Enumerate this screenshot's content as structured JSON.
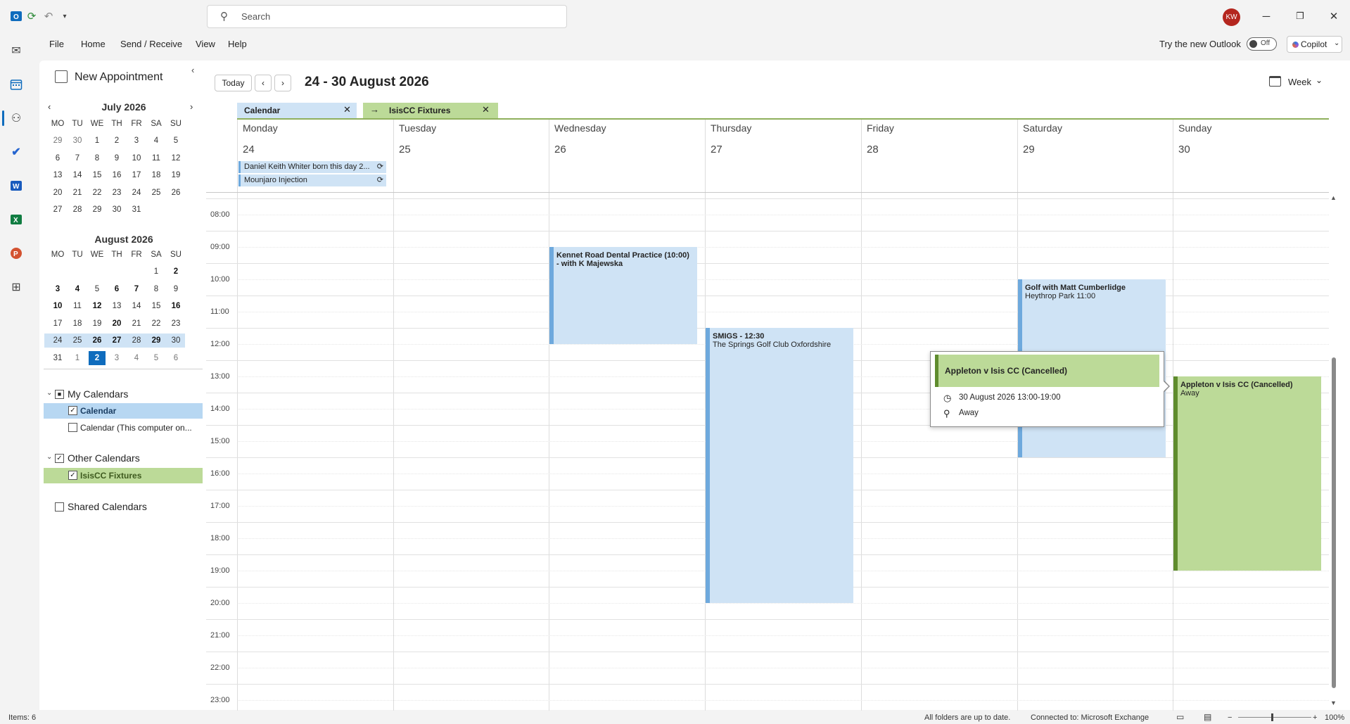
{
  "app": {
    "search_placeholder": "Search",
    "avatar_initials": "KW",
    "brand_color": "#0f6cbd"
  },
  "menu": [
    "File",
    "Home",
    "Send / Receive",
    "View",
    "Help"
  ],
  "try_new": {
    "label": "Try the new Outlook",
    "toggle": "Off"
  },
  "copilot_label": "Copilot",
  "folder": {
    "new_appointment": "New Appointment",
    "july": {
      "title": "July 2026",
      "dow": [
        "MO",
        "TU",
        "WE",
        "TH",
        "FR",
        "SA",
        "SU"
      ],
      "weeks": [
        [
          "29",
          "30",
          "1",
          "2",
          "3",
          "4",
          "5"
        ],
        [
          "6",
          "7",
          "8",
          "9",
          "10",
          "11",
          "12"
        ],
        [
          "13",
          "14",
          "15",
          "16",
          "17",
          "18",
          "19"
        ],
        [
          "20",
          "21",
          "22",
          "23",
          "24",
          "25",
          "26"
        ],
        [
          "27",
          "28",
          "29",
          "30",
          "31",
          "",
          ""
        ]
      ]
    },
    "august": {
      "title": "August 2026",
      "dow": [
        "MO",
        "TU",
        "WE",
        "TH",
        "FR",
        "SA",
        "SU"
      ],
      "weeks": [
        [
          "",
          "",
          "",
          "",
          "",
          "1",
          "2"
        ],
        [
          "3",
          "4",
          "5",
          "6",
          "7",
          "8",
          "9"
        ],
        [
          "10",
          "11",
          "12",
          "13",
          "14",
          "15",
          "16"
        ],
        [
          "17",
          "18",
          "19",
          "20",
          "21",
          "22",
          "23"
        ],
        [
          "24",
          "25",
          "26",
          "27",
          "28",
          "29",
          "30"
        ],
        [
          "31",
          "1",
          "2",
          "3",
          "4",
          "5",
          "6"
        ]
      ],
      "bold_days": [
        "2",
        "3",
        "4",
        "6",
        "7",
        "10",
        "12",
        "16",
        "20",
        "26",
        "27",
        "29"
      ],
      "selected_week_index": 4,
      "today": "2"
    },
    "my_calendars": "My Calendars",
    "calendar_item": "Calendar",
    "calendar_local": "Calendar (This computer on...",
    "other_calendars": "Other Calendars",
    "isiscc_item": "IsisCC Fixtures",
    "shared_calendars": "Shared Calendars"
  },
  "toolbar": {
    "today": "Today",
    "date_range": "24 - 30 August 2026",
    "view": "Week"
  },
  "tabs": {
    "calendar": "Calendar",
    "isiscc": "IsisCC Fixtures"
  },
  "days": [
    {
      "name": "Monday",
      "num": "24"
    },
    {
      "name": "Tuesday",
      "num": "25"
    },
    {
      "name": "Wednesday",
      "num": "26"
    },
    {
      "name": "Thursday",
      "num": "27"
    },
    {
      "name": "Friday",
      "num": "28"
    },
    {
      "name": "Saturday",
      "num": "29"
    },
    {
      "name": "Sunday",
      "num": "30"
    }
  ],
  "all_day": [
    {
      "title": "Daniel Keith Whiter born this day 2..."
    },
    {
      "title": "Mounjaro Injection"
    }
  ],
  "times": [
    "08:00",
    "09:00",
    "10:00",
    "11:00",
    "12:00",
    "13:00",
    "14:00",
    "15:00",
    "16:00",
    "17:00",
    "18:00",
    "19:00",
    "20:00",
    "21:00",
    "22:00",
    "23:00"
  ],
  "events": {
    "dental": {
      "title": "Kennet Road Dental Practice (10:00) - with K Majewska"
    },
    "smigs": {
      "title": "SMIGS - 12:30",
      "location": "The Springs Golf Club Oxfordshire"
    },
    "golf": {
      "title": "Golf with Matt Cumberlidge",
      "location": "Heythrop Park 11:00"
    },
    "appleton": {
      "title": "Appleton v Isis CC (Cancelled)",
      "location": "Away"
    }
  },
  "popup": {
    "title": "Appleton v Isis CC (Cancelled)",
    "when": "30 August 2026 13:00-19:00",
    "where": "Away"
  },
  "status": {
    "items": "Items: 6",
    "sync": "All folders are up to date.",
    "connection": "Connected to: Microsoft Exchange",
    "zoom": "100%"
  }
}
